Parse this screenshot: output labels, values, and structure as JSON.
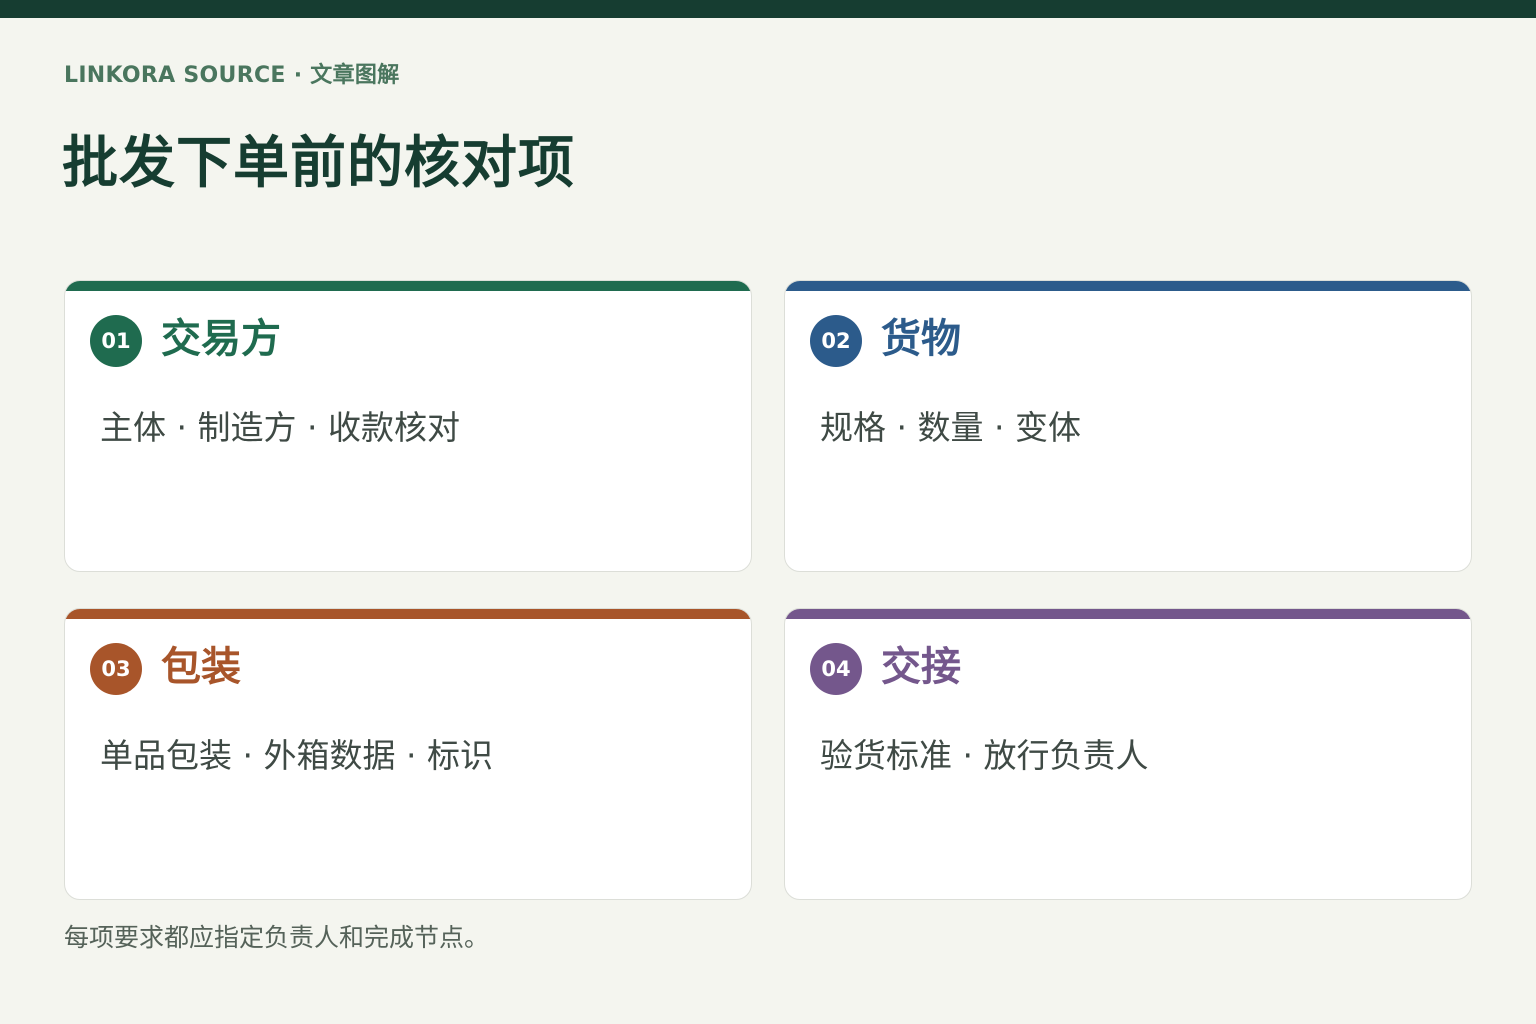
{
  "header": {
    "kicker": "LINKORA SOURCE · 文章图解",
    "title": "批发下单前的核对项"
  },
  "cards": [
    {
      "number": "01",
      "title": "交易方",
      "body": "主体 · 制造方 · 收款核对",
      "color": "#1f6b4f"
    },
    {
      "number": "02",
      "title": "货物",
      "body": "规格 · 数量 · 变体",
      "color": "#2c5b8b"
    },
    {
      "number": "03",
      "title": "包装",
      "body": "单品包装 · 外箱数据 · 标识",
      "color": "#a8552a"
    },
    {
      "number": "04",
      "title": "交接",
      "body": "验货标准 · 放行负责人",
      "color": "#74578c"
    }
  ],
  "footer": {
    "note": "每项要求都应指定负责人和完成节点。"
  },
  "colors": {
    "background": "#f4f5ef",
    "top_bar": "#163d31",
    "title": "#163d31",
    "kicker": "#4a765e"
  }
}
